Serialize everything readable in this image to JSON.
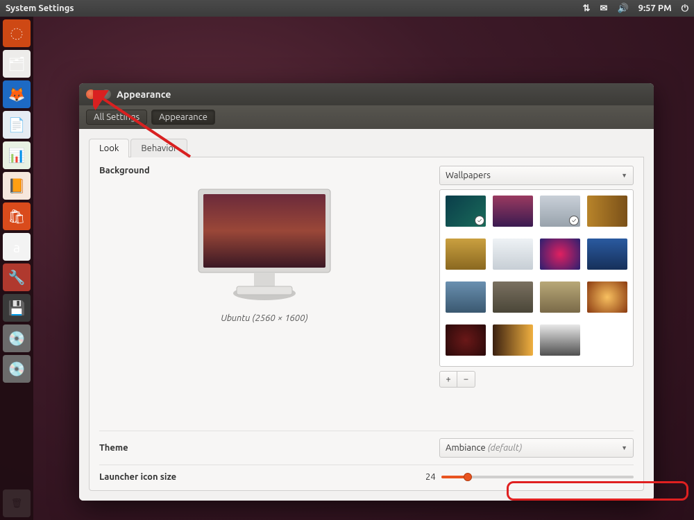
{
  "top_panel": {
    "title": "System Settings",
    "time": "9:57 PM"
  },
  "launcher_icons": [
    {
      "name": "ubuntu-dash-icon",
      "bg": "#ce4814",
      "glyph": "◌"
    },
    {
      "name": "files-icon",
      "bg": "#edecea",
      "glyph": "🗂"
    },
    {
      "name": "firefox-icon",
      "bg": "#1d6ac4",
      "glyph": "🦊"
    },
    {
      "name": "writer-icon",
      "bg": "#e6ecf3",
      "glyph": "📄"
    },
    {
      "name": "calc-icon",
      "bg": "#e8f1e3",
      "glyph": "📊"
    },
    {
      "name": "impress-icon",
      "bg": "#f6e7dd",
      "glyph": "📙"
    },
    {
      "name": "software-center-icon",
      "bg": "#d94b1c",
      "glyph": "🛍"
    },
    {
      "name": "amazon-icon",
      "bg": "#f3f3f3",
      "glyph": "a"
    },
    {
      "name": "settings-icon",
      "bg": "#b0392e",
      "glyph": "🔧"
    },
    {
      "name": "floppy-icon",
      "bg": "#3a3a3a",
      "glyph": "💾"
    },
    {
      "name": "disc1-icon",
      "bg": "#6b6b6b",
      "glyph": "💿"
    },
    {
      "name": "disc2-icon",
      "bg": "#6b6b6b",
      "glyph": "💿"
    }
  ],
  "window": {
    "title": "Appearance",
    "breadcrumbs": {
      "all": "All Settings",
      "current": "Appearance"
    },
    "tabs": {
      "look": "Look",
      "behavior": "Behavior"
    },
    "background": {
      "label": "Background",
      "caption": "Ubuntu (2560 × 1600)",
      "source_dropdown": "Wallpapers"
    },
    "thumbs": [
      {
        "name": "wall-1",
        "bg": "linear-gradient(135deg,#0a3d4a,#1a6b5a)",
        "checked": true
      },
      {
        "name": "wall-2",
        "bg": "linear-gradient(180deg,#9a3a60,#3a1a50)",
        "checked": false
      },
      {
        "name": "wall-3",
        "bg": "linear-gradient(180deg,#c9d0d8,#98a2ac)",
        "checked": true
      },
      {
        "name": "wall-4",
        "bg": "linear-gradient(90deg,#b8842a,#7a5018)",
        "checked": false
      },
      {
        "name": "wall-5",
        "bg": "linear-gradient(180deg,#caa040,#8a6820)",
        "checked": false
      },
      {
        "name": "wall-6",
        "bg": "linear-gradient(180deg,#eef2f5,#c7ced5)",
        "checked": false
      },
      {
        "name": "wall-7",
        "bg": "radial-gradient(circle at 50% 50%,#e02060,#2a2070)",
        "checked": false
      },
      {
        "name": "wall-8",
        "bg": "linear-gradient(180deg,#2a5aa0,#16305a)",
        "checked": false
      },
      {
        "name": "wall-9",
        "bg": "linear-gradient(180deg,#6a90b0,#3a5870)",
        "checked": false
      },
      {
        "name": "wall-10",
        "bg": "linear-gradient(180deg,#7a7060,#4a4638)",
        "checked": false
      },
      {
        "name": "wall-11",
        "bg": "linear-gradient(180deg,#b8a878,#7a6a48)",
        "checked": false
      },
      {
        "name": "wall-12",
        "bg": "radial-gradient(circle at 50% 50%,#f8c060,#8a3a10)",
        "checked": false
      },
      {
        "name": "wall-13",
        "bg": "radial-gradient(circle at 50% 50%,#6a1818,#2a0a0a)",
        "checked": false
      },
      {
        "name": "wall-14",
        "bg": "linear-gradient(90deg,#3a2010,#f0b040)",
        "checked": false
      },
      {
        "name": "wall-15",
        "bg": "linear-gradient(180deg,#e8e8e8,#505050)",
        "checked": false
      }
    ],
    "theme": {
      "label": "Theme",
      "value": "Ambiance",
      "suffix": "(default)"
    },
    "launcher_size": {
      "label": "Launcher icon size",
      "value": "24",
      "percent": 14
    }
  }
}
